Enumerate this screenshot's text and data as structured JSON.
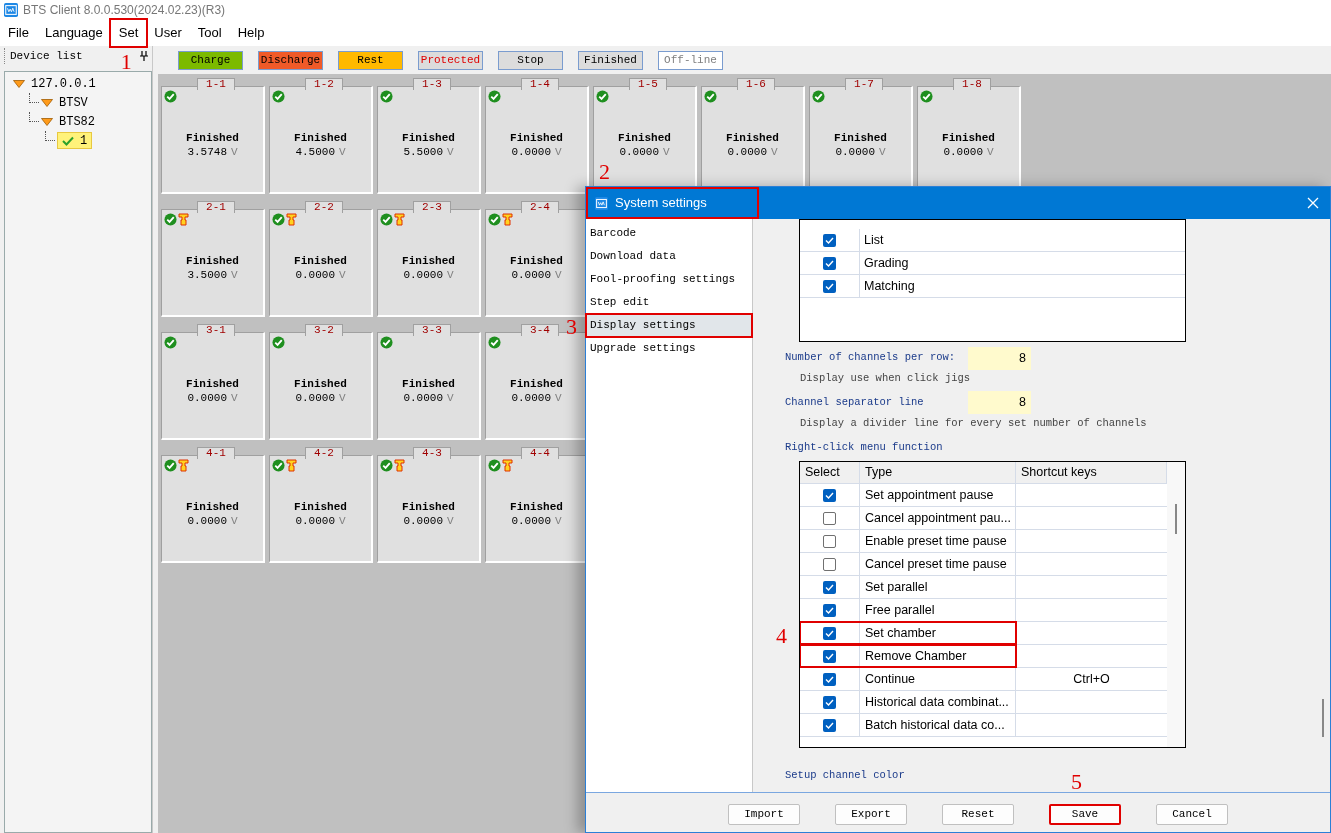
{
  "window": {
    "title": "BTS Client 8.0.0.530(2024.02.23)(R3)"
  },
  "menu": [
    {
      "label": "File",
      "highlighted": false
    },
    {
      "label": "Language",
      "highlighted": false
    },
    {
      "label": "Set",
      "highlighted": true,
      "annotation": "1"
    },
    {
      "label": "User",
      "highlighted": false
    },
    {
      "label": "Tool",
      "highlighted": false
    },
    {
      "label": "Help",
      "highlighted": false
    }
  ],
  "device_list": {
    "title": "Device list",
    "tree": [
      {
        "label": "127.0.0.1",
        "kind": "node",
        "selected": false,
        "children": [
          {
            "label": "BTSV",
            "kind": "node",
            "selected": false
          },
          {
            "label": "BTS82",
            "kind": "node",
            "selected": false,
            "children": [
              {
                "label": "1",
                "kind": "channel",
                "selected": true
              }
            ]
          }
        ]
      }
    ]
  },
  "legend": [
    {
      "label": "Charge",
      "color": "#7cba00",
      "kind": "normal"
    },
    {
      "label": "Discharge",
      "color": "#f05a28",
      "kind": "normal"
    },
    {
      "label": "Rest",
      "color": "#ffb900",
      "kind": "normal"
    },
    {
      "label": "Protected",
      "color": "#dcdcdc",
      "kind": "alert"
    },
    {
      "label": "Stop",
      "color": "#dcdcdc",
      "kind": "normal"
    },
    {
      "label": "Finished",
      "color": "#dcdcdc",
      "kind": "normal"
    },
    {
      "label": "Off-line",
      "color": "#ffffff",
      "kind": "inactive"
    }
  ],
  "channel_rows": [
    [
      {
        "label": "1-1",
        "status": "Finished",
        "voltage": "3.5748",
        "unit": "V",
        "plug": false
      },
      {
        "label": "1-2",
        "status": "Finished",
        "voltage": "4.5000",
        "unit": "V",
        "plug": false
      },
      {
        "label": "1-3",
        "status": "Finished",
        "voltage": "5.5000",
        "unit": "V",
        "plug": false
      },
      {
        "label": "1-4",
        "status": "Finished",
        "voltage": "0.0000",
        "unit": "V",
        "plug": false
      },
      {
        "label": "1-5",
        "status": "Finished",
        "voltage": "0.0000",
        "unit": "V",
        "plug": false
      },
      {
        "label": "1-6",
        "status": "Finished",
        "voltage": "0.0000",
        "unit": "V",
        "plug": false
      },
      {
        "label": "1-7",
        "status": "Finished",
        "voltage": "0.0000",
        "unit": "V",
        "plug": false
      },
      {
        "label": "1-8",
        "status": "Finished",
        "voltage": "0.0000",
        "unit": "V",
        "plug": false
      }
    ],
    [
      {
        "label": "2-1",
        "status": "Finished",
        "voltage": "3.5000",
        "unit": "V",
        "plug": true
      },
      {
        "label": "2-2",
        "status": "Finished",
        "voltage": "0.0000",
        "unit": "V",
        "plug": true
      },
      {
        "label": "2-3",
        "status": "Finished",
        "voltage": "0.0000",
        "unit": "V",
        "plug": true
      },
      {
        "label": "2-4",
        "status": "Finished",
        "voltage": "0.0000",
        "unit": "V",
        "plug": true
      }
    ],
    [
      {
        "label": "3-1",
        "status": "Finished",
        "voltage": "0.0000",
        "unit": "V",
        "plug": false
      },
      {
        "label": "3-2",
        "status": "Finished",
        "voltage": "0.0000",
        "unit": "V",
        "plug": false
      },
      {
        "label": "3-3",
        "status": "Finished",
        "voltage": "0.0000",
        "unit": "V",
        "plug": false
      },
      {
        "label": "3-4",
        "status": "Finished",
        "voltage": "0.0000",
        "unit": "V",
        "plug": false
      }
    ],
    [
      {
        "label": "4-1",
        "status": "Finished",
        "voltage": "0.0000",
        "unit": "V",
        "plug": true
      },
      {
        "label": "4-2",
        "status": "Finished",
        "voltage": "0.0000",
        "unit": "V",
        "plug": true
      },
      {
        "label": "4-3",
        "status": "Finished",
        "voltage": "0.0000",
        "unit": "V",
        "plug": true
      },
      {
        "label": "4-4",
        "status": "Finished",
        "voltage": "0.0000",
        "unit": "V",
        "plug": true
      }
    ]
  ],
  "dialog": {
    "title": "System settings",
    "highlighted": true,
    "annotation": "2",
    "nav": [
      {
        "label": "Barcode",
        "selected": false,
        "highlighted": false
      },
      {
        "label": "Download data",
        "selected": false,
        "highlighted": false
      },
      {
        "label": "Fool-proofing settings",
        "selected": false,
        "highlighted": false
      },
      {
        "label": "Step edit",
        "selected": false,
        "highlighted": false
      },
      {
        "label": "Display settings",
        "selected": true,
        "highlighted": true,
        "annotation": "3"
      },
      {
        "label": "Upgrade settings",
        "selected": false,
        "highlighted": false
      }
    ],
    "view_table": [
      {
        "type": "List",
        "checked": true
      },
      {
        "type": "Grading",
        "checked": true
      },
      {
        "type": "Matching",
        "checked": true
      }
    ],
    "fields": [
      {
        "label": "Number of channels per row:",
        "value": "8",
        "hint": "Display use when click jigs"
      },
      {
        "label": "Channel separator line",
        "value": "8",
        "hint": "Display a divider line for every set number of channels"
      }
    ],
    "menu_section": "Right-click menu function",
    "menu_table": {
      "columns": [
        "Select",
        "Type",
        "Shortcut keys"
      ],
      "annotation": "4",
      "rows": [
        {
          "type": "Set appointment pause",
          "checked": true,
          "highlighted": false
        },
        {
          "type": "Cancel appointment pau...",
          "checked": false,
          "highlighted": false
        },
        {
          "type": "Enable preset time pause",
          "checked": false,
          "highlighted": false
        },
        {
          "type": "Cancel preset time pause",
          "checked": false,
          "highlighted": false
        },
        {
          "type": "Set parallel",
          "checked": true,
          "highlighted": false
        },
        {
          "type": "Free parallel",
          "checked": true,
          "highlighted": false
        },
        {
          "type": "Set chamber",
          "checked": true,
          "highlighted": true
        },
        {
          "type": "Remove Chamber",
          "checked": true,
          "highlighted": true
        },
        {
          "type": "Continue",
          "shortcut": "Ctrl+O",
          "checked": true,
          "highlighted": false
        },
        {
          "type": "Historical data combinat...",
          "checked": true,
          "highlighted": false
        },
        {
          "type": "Batch historical data co...",
          "checked": true,
          "highlighted": false
        }
      ]
    },
    "color_section": "Setup channel color",
    "buttons": [
      {
        "label": "Import",
        "highlighted": false
      },
      {
        "label": "Export",
        "highlighted": false
      },
      {
        "label": "Reset",
        "highlighted": false
      },
      {
        "label": "Save",
        "highlighted": true,
        "annotation": "5"
      },
      {
        "label": "Cancel",
        "highlighted": false
      }
    ]
  }
}
